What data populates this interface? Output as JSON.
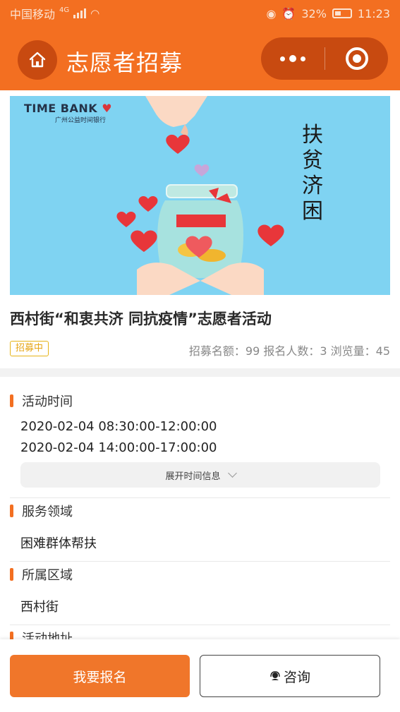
{
  "status_bar": {
    "carrier": "中国移动",
    "network": "4G",
    "battery": "32%",
    "time": "11:23"
  },
  "header": {
    "title": "志愿者招募",
    "home_icon": "home-icon",
    "more_icon": "more-dots-icon",
    "close_icon": "target-circle-icon"
  },
  "banner": {
    "logo_main": "TIME BANK",
    "logo_sub": "广州公益时间银行",
    "calligraphy": [
      "扶",
      "贫",
      "济",
      "困"
    ]
  },
  "event": {
    "title": "西村街“和衷共济 同抗疫情”志愿者活动",
    "status": "招募中",
    "stats": "招募名额：99 报名人数：3 浏览量：45"
  },
  "sections": {
    "time": {
      "label": "活动时间",
      "slots": [
        "2020-02-04 08:30:00-12:00:00",
        "2020-02-04 14:00:00-17:00:00"
      ],
      "expand_label": "展开时间信息"
    },
    "field": {
      "label": "服务领域",
      "value": "困难群体帮扶"
    },
    "area": {
      "label": "所属区域",
      "value": "西村街"
    },
    "address": {
      "label": "活动地址"
    }
  },
  "actions": {
    "signup": "我要报名",
    "consult": "咨询"
  },
  "colors": {
    "brand_orange": "#f36f21",
    "badge_yellow": "#e6a617",
    "banner_sky": "#7fd3f2"
  }
}
